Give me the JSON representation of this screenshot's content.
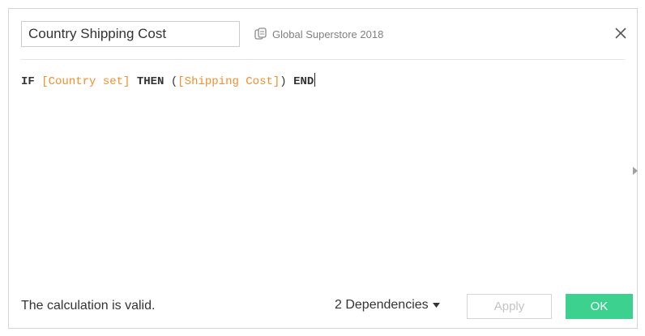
{
  "header": {
    "calculation_name": "Country Shipping Cost",
    "datasource": "Global Superstore 2018"
  },
  "editor": {
    "tokens": [
      {
        "text": "IF",
        "kind": "keyword"
      },
      {
        "text": " ",
        "kind": "space"
      },
      {
        "text": "[Country set]",
        "kind": "field"
      },
      {
        "text": " ",
        "kind": "space"
      },
      {
        "text": "THEN",
        "kind": "keyword"
      },
      {
        "text": " (",
        "kind": "plain"
      },
      {
        "text": "[Shipping Cost]",
        "kind": "field"
      },
      {
        "text": ") ",
        "kind": "plain"
      },
      {
        "text": "END",
        "kind": "keyword"
      }
    ]
  },
  "footer": {
    "status": "The calculation is valid.",
    "dependencies_label": "2 Dependencies",
    "apply_label": "Apply",
    "ok_label": "OK"
  },
  "colors": {
    "field": "#f28e2b",
    "ok_button": "#3dd18f"
  }
}
